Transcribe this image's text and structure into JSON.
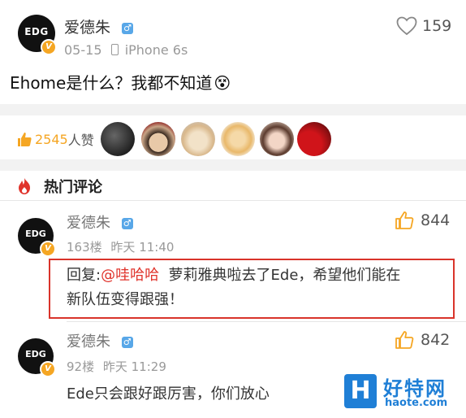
{
  "post": {
    "author": "爱德朱",
    "date": "05-15",
    "device": "iPhone 6s",
    "like_count": "159",
    "text": "Ehome是什么？我都不知道",
    "emoji": "😵"
  },
  "likes_row": {
    "count": "2545",
    "label": "人赞",
    "avatars": [
      "avatar-1",
      "avatar-2",
      "avatar-3",
      "avatar-4",
      "avatar-5",
      "avatar-6"
    ]
  },
  "section": {
    "title": "热门评论"
  },
  "comments": [
    {
      "author": "爱德朱",
      "floor": "163楼",
      "time": "昨天 11:40",
      "like_count": "844",
      "reply_prefix": "回复:",
      "mention": "@哇哈哈",
      "text_line1": "萝莉雅典啦去了Ede，希望他们能在",
      "text_line2": "新队伍变得跟强！"
    },
    {
      "author": "爱德朱",
      "floor": "92楼",
      "time": "昨天 11:29",
      "like_count": "842",
      "text": "Ede只会跟好跟厉害，你们放心"
    }
  ],
  "avatar_logo": "EDG",
  "verified_badge": "V",
  "watermark": {
    "name": "好特网",
    "url": "haote.com"
  },
  "colors": {
    "accent_orange": "#f5a623",
    "mention_red": "#e0332b",
    "highlight_red": "#d9342b",
    "male_blue": "#58a7e8",
    "hot_red": "#e0332b"
  }
}
